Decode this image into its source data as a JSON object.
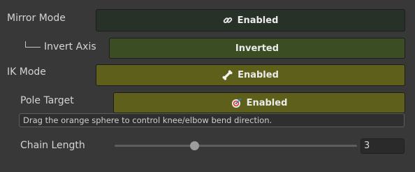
{
  "mirror_mode": {
    "label": "Mirror Mode",
    "button_label": "Enabled",
    "icon": "link-icon",
    "color": "#283128"
  },
  "invert_axis": {
    "label": "Invert Axis",
    "button_label": "Inverted",
    "color": "#3b4d22"
  },
  "ik_mode": {
    "label": "IK Mode",
    "button_label": "Enabled",
    "icon": "bone-icon",
    "color": "#5e5f1a"
  },
  "pole_target": {
    "label": "Pole Target",
    "button_label": "Enabled",
    "icon": "target-icon",
    "color": "#5e5f1a",
    "help_text": "Drag the orange sphere to control knee/elbow bend direction."
  },
  "chain_length": {
    "label": "Chain Length",
    "value": "3",
    "slider_fraction": 0.33
  }
}
